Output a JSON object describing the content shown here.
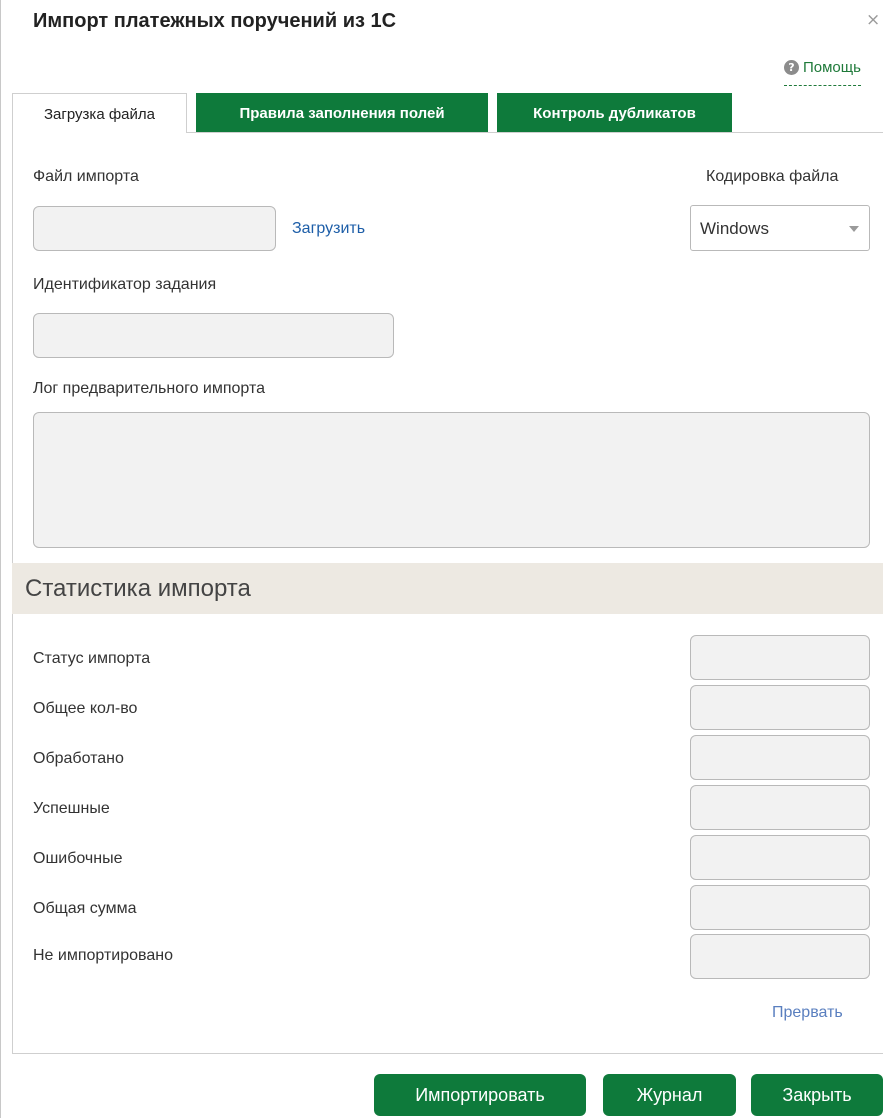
{
  "window": {
    "title": "Импорт платежных поручений из 1С",
    "close_glyph": "×",
    "help_label": "Помощь",
    "help_icon": "?"
  },
  "tabs": [
    {
      "label": "Загрузка файла",
      "active": true
    },
    {
      "label": "Правила заполнения полей",
      "active": false
    },
    {
      "label": "Контроль дубликатов",
      "active": false
    }
  ],
  "form": {
    "file_label": "Файл импорта",
    "file_value": "",
    "upload_link": "Загрузить",
    "encoding_label": "Кодировка файла",
    "encoding_value": "Windows",
    "task_id_label": "Идентификатор задания",
    "task_id_value": "",
    "log_label": "Лог предварительного импорта",
    "log_value": ""
  },
  "stats": {
    "header": "Статистика импорта",
    "rows": [
      {
        "label": "Статус импорта",
        "value": ""
      },
      {
        "label": "Общее кол-во",
        "value": ""
      },
      {
        "label": "Обработано",
        "value": ""
      },
      {
        "label": "Успешные",
        "value": ""
      },
      {
        "label": "Ошибочные",
        "value": ""
      },
      {
        "label": "Общая сумма",
        "value": ""
      },
      {
        "label": "Не импортировано",
        "value": ""
      }
    ],
    "abort_link": "Прервать"
  },
  "buttons": {
    "import": "Импортировать",
    "journal": "Журнал",
    "close": "Закрыть"
  },
  "colors": {
    "accent_green": "#0e7a3b",
    "link_blue": "#1d5ea8",
    "stat_header_bg": "#ede9e2"
  }
}
